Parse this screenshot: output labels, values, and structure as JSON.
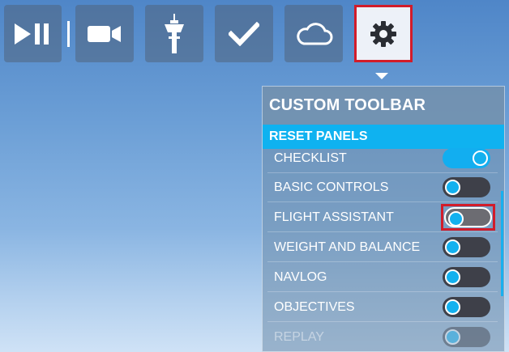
{
  "toolbar": {
    "buttons": [
      {
        "id": "play-pause",
        "icon": "play-pause-icon"
      },
      {
        "id": "camera",
        "icon": "video-camera-icon"
      },
      {
        "id": "atc",
        "icon": "control-tower-icon"
      },
      {
        "id": "checklist",
        "icon": "checkmark-icon"
      },
      {
        "id": "weather",
        "icon": "cloud-icon"
      },
      {
        "id": "settings",
        "icon": "gear-icon",
        "selected": true
      }
    ]
  },
  "panel": {
    "title": "CUSTOM TOOLBAR",
    "reset_label": "RESET PANELS",
    "items": [
      {
        "label": "CHECKLIST",
        "enabled": true
      },
      {
        "label": "BASIC CONTROLS",
        "enabled": false
      },
      {
        "label": "FLIGHT ASSISTANT",
        "enabled": false
      },
      {
        "label": "WEIGHT AND BALANCE",
        "enabled": false
      },
      {
        "label": "NAVLOG",
        "enabled": false
      },
      {
        "label": "OBJECTIVES",
        "enabled": false
      },
      {
        "label": "REPLAY",
        "enabled": false
      }
    ]
  },
  "colors": {
    "accent": "#0fb2f0",
    "highlight_border": "#d21c2a",
    "toggle_off_track": "#3e4049"
  }
}
